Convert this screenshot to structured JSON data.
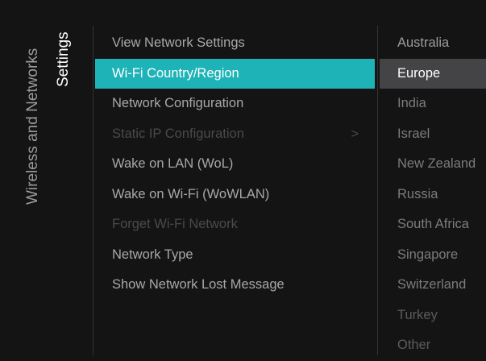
{
  "breadcrumb": {
    "root": "Wireless and Networks",
    "current": "Settings"
  },
  "menu": {
    "items": [
      {
        "label": "View Network Settings",
        "state": "normal"
      },
      {
        "label": "Wi-Fi Country/Region",
        "state": "selected"
      },
      {
        "label": "Network Configuration",
        "state": "normal"
      },
      {
        "label": "Static IP Configuration",
        "state": "disabled",
        "chevron": ">"
      },
      {
        "label": "Wake on LAN (WoL)",
        "state": "normal"
      },
      {
        "label": "Wake on Wi-Fi (WoWLAN)",
        "state": "normal"
      },
      {
        "label": "Forget Wi-Fi Network",
        "state": "disabled"
      },
      {
        "label": "Network Type",
        "state": "normal"
      },
      {
        "label": "Show Network Lost Message",
        "state": "normal"
      }
    ]
  },
  "options": {
    "items": [
      {
        "label": "Australia",
        "state": "normal"
      },
      {
        "label": "Europe",
        "state": "selected"
      },
      {
        "label": "India",
        "state": "normal"
      },
      {
        "label": "Israel",
        "state": "normal"
      },
      {
        "label": "New Zealand",
        "state": "normal"
      },
      {
        "label": "Russia",
        "state": "normal"
      },
      {
        "label": "South Africa",
        "state": "normal"
      },
      {
        "label": "Singapore",
        "state": "normal"
      },
      {
        "label": "Switzerland",
        "state": "normal"
      },
      {
        "label": "Turkey",
        "state": "normal"
      },
      {
        "label": "Other",
        "state": "normal"
      }
    ]
  },
  "colors": {
    "background": "#141414",
    "accent": "#1eb3b7",
    "option_highlight": "#444446"
  }
}
